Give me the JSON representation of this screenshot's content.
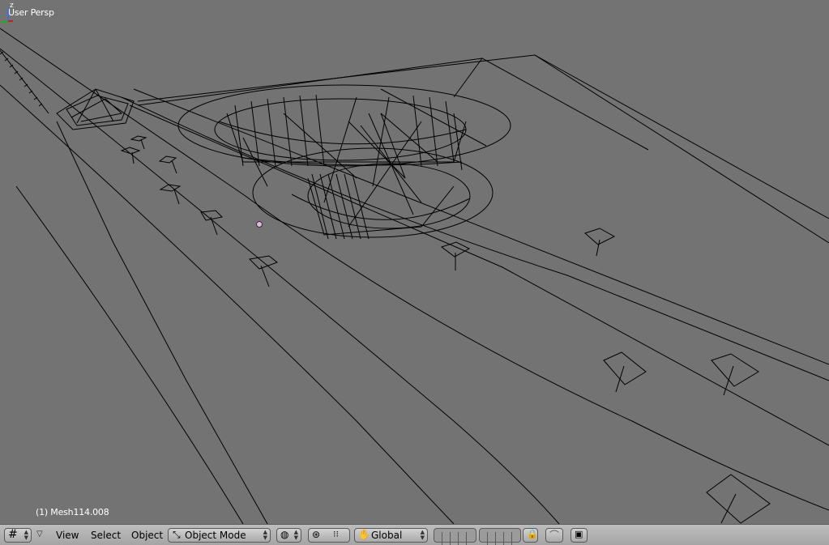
{
  "viewport": {
    "view_name": "User Persp",
    "object_name": "(1) Mesh114.008",
    "axis_label": "z"
  },
  "header": {
    "editor_type_icon": "grid-editor-icon",
    "menus": [
      "View",
      "Select",
      "Object"
    ],
    "mode": {
      "icon": "object-mode-icon",
      "label": "Object Mode"
    },
    "shading_icon": "wireframe-sphere-icon",
    "pivot_icon": "pivot-point-icon",
    "manipulator_icon": "manipulator-icon",
    "transform_orientation": {
      "icon": "hand-icon",
      "label": "Global"
    },
    "layers_icon": "layer-buttons",
    "lock_icon": "lock-icon",
    "snap_icon": "snap-icon",
    "render_icon": "render-image-icon"
  },
  "colors": {
    "viewport_bg": "#737373",
    "wire": "#000000",
    "header_bg": "#b5b5b5"
  }
}
